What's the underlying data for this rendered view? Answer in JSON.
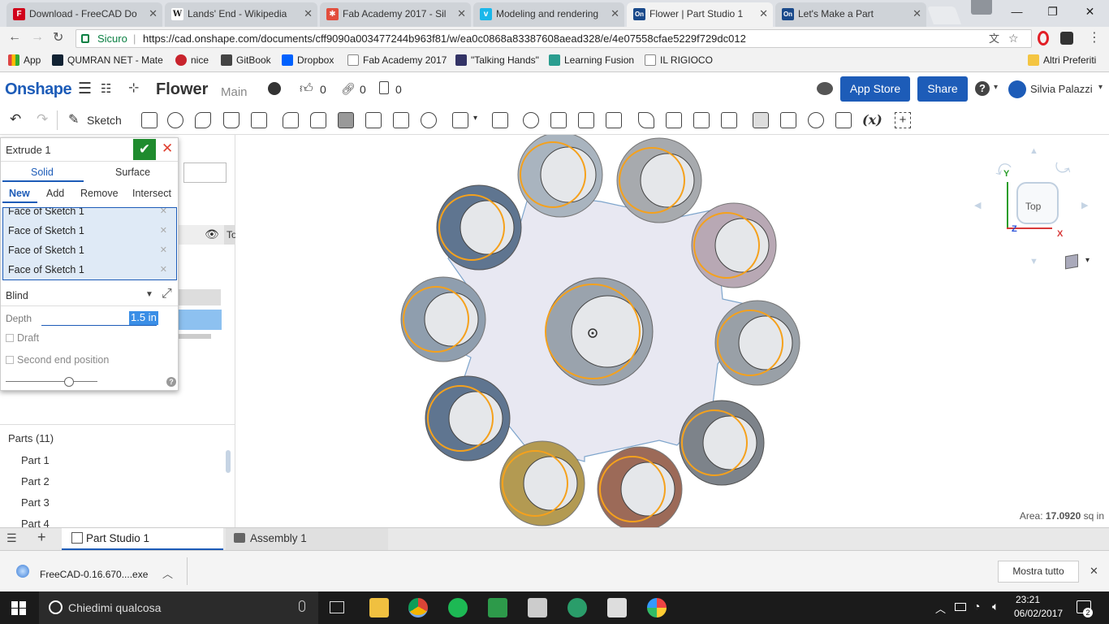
{
  "browser": {
    "tabs": [
      {
        "title": "Download - FreeCAD Do",
        "favicon": "freecad-icon",
        "color": "#d0021b"
      },
      {
        "title": "Lands' End - Wikipedia",
        "favicon": "wikipedia-icon",
        "color": "#555555"
      },
      {
        "title": "Fab Academy 2017 - Sil",
        "favicon": "fab-icon",
        "color": "#e24d3c"
      },
      {
        "title": "Modeling and rendering",
        "favicon": "vimeo-icon",
        "color": "#1ab7ea"
      },
      {
        "title": "Flower | Part Studio 1",
        "favicon": "onshape-icon",
        "color": "#1a4a8b"
      },
      {
        "title": "Let's Make a Part",
        "favicon": "onshape-icon",
        "color": "#1a4a8b"
      }
    ],
    "secure_label": "Sicuro",
    "url": "https://cad.onshape.com/documents/cff9090a003477244b963f81/w/ea0c0868a83387608aead328/e/4e07558cfae5229f729dc012",
    "bookmarks": [
      {
        "label": "App",
        "color": "#d44"
      },
      {
        "label": "QUMRAN NET - Mate",
        "color": "#123"
      },
      {
        "label": "nice",
        "color": "#c8232c"
      },
      {
        "label": "GitBook",
        "color": "#444"
      },
      {
        "label": "Dropbox",
        "color": "#0061fe"
      },
      {
        "label": "Fab Academy 2017",
        "color": "#888"
      },
      {
        "label": "\"Talking Hands\"",
        "color": "#336"
      },
      {
        "label": "Learning Fusion",
        "color": "#2a9d8f"
      },
      {
        "label": "IL RIGIOCO",
        "color": "#888"
      }
    ],
    "other_bookmarks": "Altri Preferiti"
  },
  "onshape": {
    "logo": "Onshape",
    "doc_title": "Flower",
    "workspace": "Main",
    "likes": "0",
    "links": "0",
    "copies": "0",
    "app_store": "App Store",
    "share": "Share",
    "user": "Silvia Palazzi",
    "sketch_label": "Sketch",
    "brand_color": "#1d5cb8"
  },
  "feature": {
    "title": "Extrude 1",
    "mode_tabs": [
      "Solid",
      "Surface"
    ],
    "ops": [
      "New",
      "Add",
      "Remove",
      "Intersect"
    ],
    "faces": [
      "Face of Sketch 1",
      "Face of Sketch 1",
      "Face of Sketch 1",
      "Face of Sketch 1"
    ],
    "end_type": "Blind",
    "depth_label": "Depth",
    "depth_value": "1.5 in",
    "draft_label": "Draft",
    "second_end_label": "Second end position",
    "top_label": "Top"
  },
  "parts": {
    "header": "Parts (11)",
    "items": [
      "Part 1",
      "Part 2",
      "Part 3",
      "Part 4"
    ]
  },
  "viewport": {
    "area_label": "Area:",
    "area_value": "17.0920",
    "area_unit": "sq in",
    "view_label": "Top",
    "axis_x": "X",
    "axis_y": "Y",
    "axis_z": "Z"
  },
  "bottom_tabs": {
    "part_studio": "Part Studio 1",
    "assembly": "Assembly 1"
  },
  "download": {
    "file": "FreeCAD-0.16.670....exe",
    "show_all": "Mostra tutto"
  },
  "taskbar": {
    "search": "Chiedimi qualcosa",
    "time": "23:21",
    "date": "06/02/2017",
    "notifications": "2"
  }
}
